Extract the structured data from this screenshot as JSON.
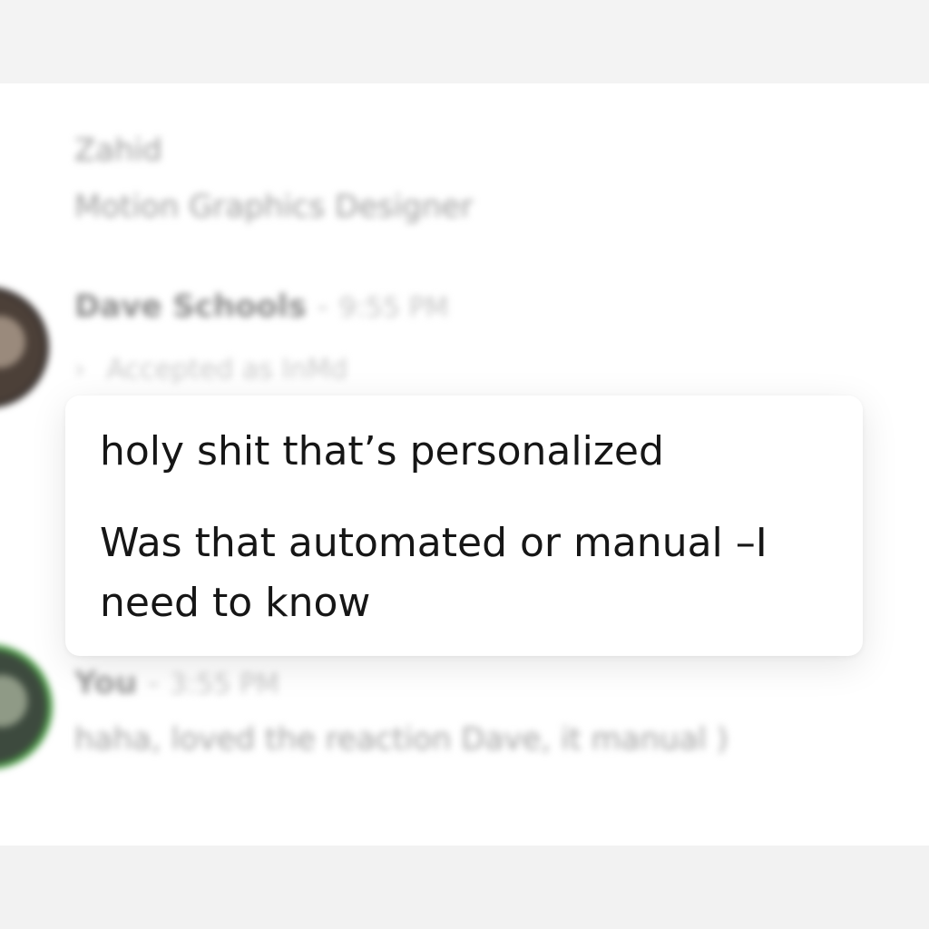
{
  "profile": {
    "name": "Zahid",
    "title": "Motion Graphics Designer"
  },
  "messages": [
    {
      "sender": "Dave Schools",
      "time": "9:55 PM",
      "event": "Accepted as InMd",
      "event_icon": "chevron-right-icon",
      "lines": [
        "holy shit that’s personalized",
        "Was that automated or manual –I need to know"
      ]
    },
    {
      "sender": "You",
      "time": "3:55 PM",
      "text": "haha, loved the reaction Dave, it manual )"
    }
  ],
  "separator": "-",
  "colors": {
    "panel_bg": "#ffffff",
    "page_bg": "#f1f1f1",
    "you_avatar_ring": "#4b9c46"
  }
}
